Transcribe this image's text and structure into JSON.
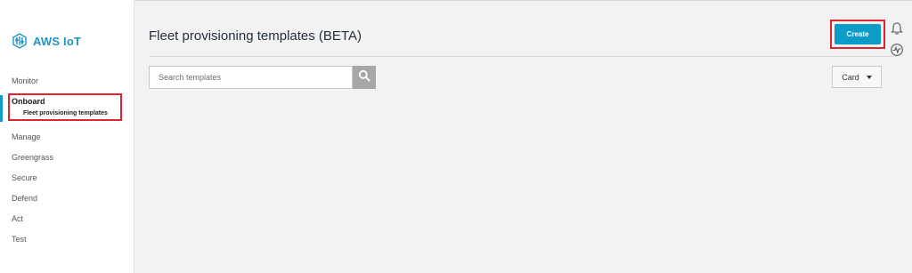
{
  "app": {
    "logo_text": "AWS IoT"
  },
  "sidebar": {
    "items": [
      {
        "label": "Monitor"
      },
      {
        "label": "Onboard",
        "active": true,
        "children": [
          {
            "label": "Fleet provisioning templates",
            "active": true
          }
        ]
      },
      {
        "label": "Manage"
      },
      {
        "label": "Greengrass"
      },
      {
        "label": "Secure"
      },
      {
        "label": "Defend"
      },
      {
        "label": "Act"
      },
      {
        "label": "Test"
      }
    ]
  },
  "main": {
    "title": "Fleet provisioning templates (BETA)",
    "create_label": "Create",
    "search": {
      "placeholder": "Search templates",
      "value": ""
    },
    "view_select": {
      "value": "Card"
    }
  },
  "colors": {
    "accent": "#0d9bc8",
    "highlight": "#e0232e",
    "logo": "#1f95c4"
  },
  "icons": [
    "aws-iot-logo-icon",
    "search-icon",
    "bell-icon",
    "activity-icon",
    "caret-down-icon"
  ]
}
